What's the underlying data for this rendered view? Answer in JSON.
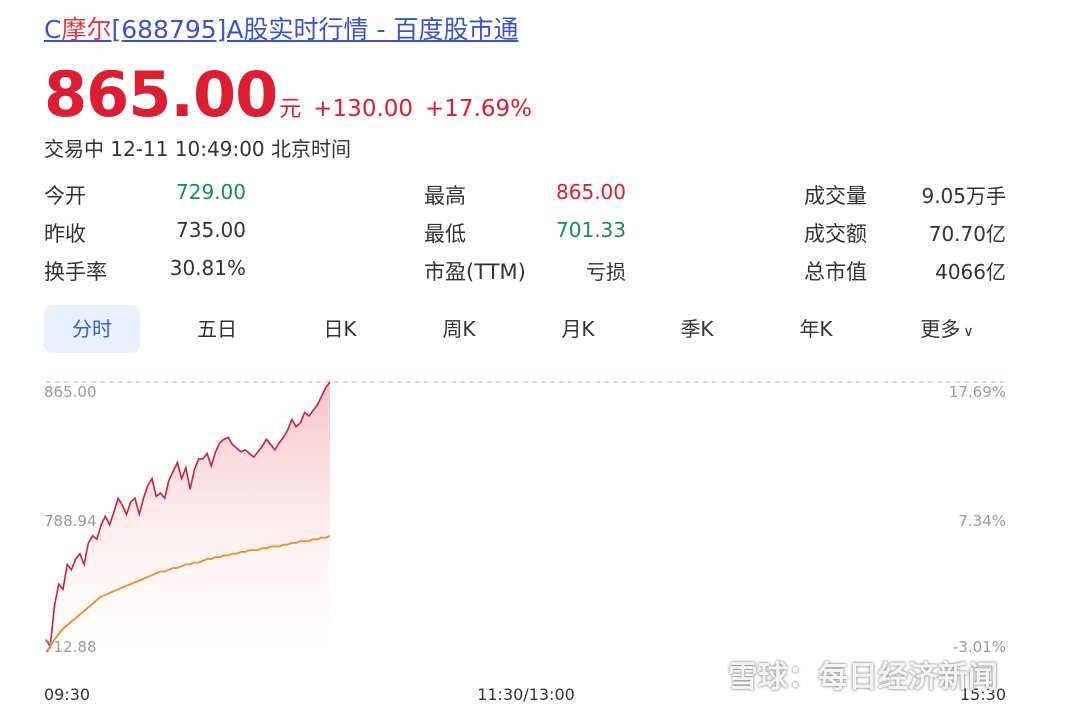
{
  "title": {
    "prefix": "C",
    "name": "摩尔",
    "rest": "[688795]A股实时行情 - 百度股市通"
  },
  "quote": {
    "price": "865.00",
    "unit": "元",
    "change": "+130.00",
    "change_pct": "+17.69%",
    "status": "交易中 12-11 10:49:00 北京时间"
  },
  "stats": [
    {
      "label": "今开",
      "value": "729.00",
      "color": "#1a8a56"
    },
    {
      "label": "最高",
      "value": "865.00",
      "color": "#dc1e32"
    },
    {
      "label": "成交量",
      "value": "9.05万手",
      "color": "#333333"
    },
    {
      "label": "昨收",
      "value": "735.00",
      "color": "#333333"
    },
    {
      "label": "最低",
      "value": "701.33",
      "color": "#1a8a56"
    },
    {
      "label": "成交额",
      "value": "70.70亿",
      "color": "#333333"
    },
    {
      "label": "换手率",
      "value": "30.81%",
      "color": "#333333"
    },
    {
      "label": "市盈(TTM)",
      "value": "亏损",
      "color": "#333333"
    },
    {
      "label": "总市值",
      "value": "4066亿",
      "color": "#333333"
    }
  ],
  "tabs": [
    "分时",
    "五日",
    "日K",
    "周K",
    "月K",
    "季K",
    "年K",
    "更多"
  ],
  "active_tab": "分时",
  "watermark": "雪球：每日经济新闻",
  "chart_data": {
    "type": "line",
    "y_labels_left": [
      "865.00",
      "788.94",
      "712.88"
    ],
    "y_labels_right": [
      "17.69%",
      "7.34%",
      "-3.01%"
    ],
    "x_labels": [
      "09:30",
      "11:30/13:00",
      "15:30"
    ],
    "ylim": [
      712.88,
      865.0
    ],
    "series": [
      {
        "color": "#cc1f3a",
        "values": [
          721,
          717,
          740,
          752,
          749,
          763,
          760,
          766,
          769,
          763,
          775,
          779,
          777,
          785,
          790,
          785,
          792,
          800,
          796,
          791,
          798,
          800,
          791,
          800,
          807,
          811,
          801,
          803,
          800,
          810,
          815,
          820,
          811,
          817,
          805,
          816,
          822,
          822,
          825,
          818,
          826,
          831,
          833,
          834,
          830,
          828,
          826,
          827,
          825,
          823,
          826,
          829,
          833,
          830,
          827,
          831,
          834,
          838,
          844,
          840,
          842,
          848,
          846,
          849,
          852,
          857,
          862,
          865
        ]
      },
      {
        "color": "#f08a24",
        "values": [
          714,
          717,
          721,
          724,
          727,
          729,
          731,
          733,
          735,
          737,
          739,
          741,
          743,
          745,
          746,
          747,
          748,
          749,
          750,
          751,
          752,
          753,
          754,
          755,
          756,
          757,
          758,
          759,
          759,
          760,
          761,
          761,
          762,
          763,
          763,
          764,
          764,
          765,
          766,
          766,
          767,
          767,
          768,
          768,
          769,
          769,
          770,
          770,
          771,
          771,
          771,
          772,
          772,
          773,
          773,
          773,
          774,
          774,
          775,
          775,
          776,
          776,
          776,
          777,
          777,
          778,
          778,
          779
        ]
      }
    ]
  }
}
